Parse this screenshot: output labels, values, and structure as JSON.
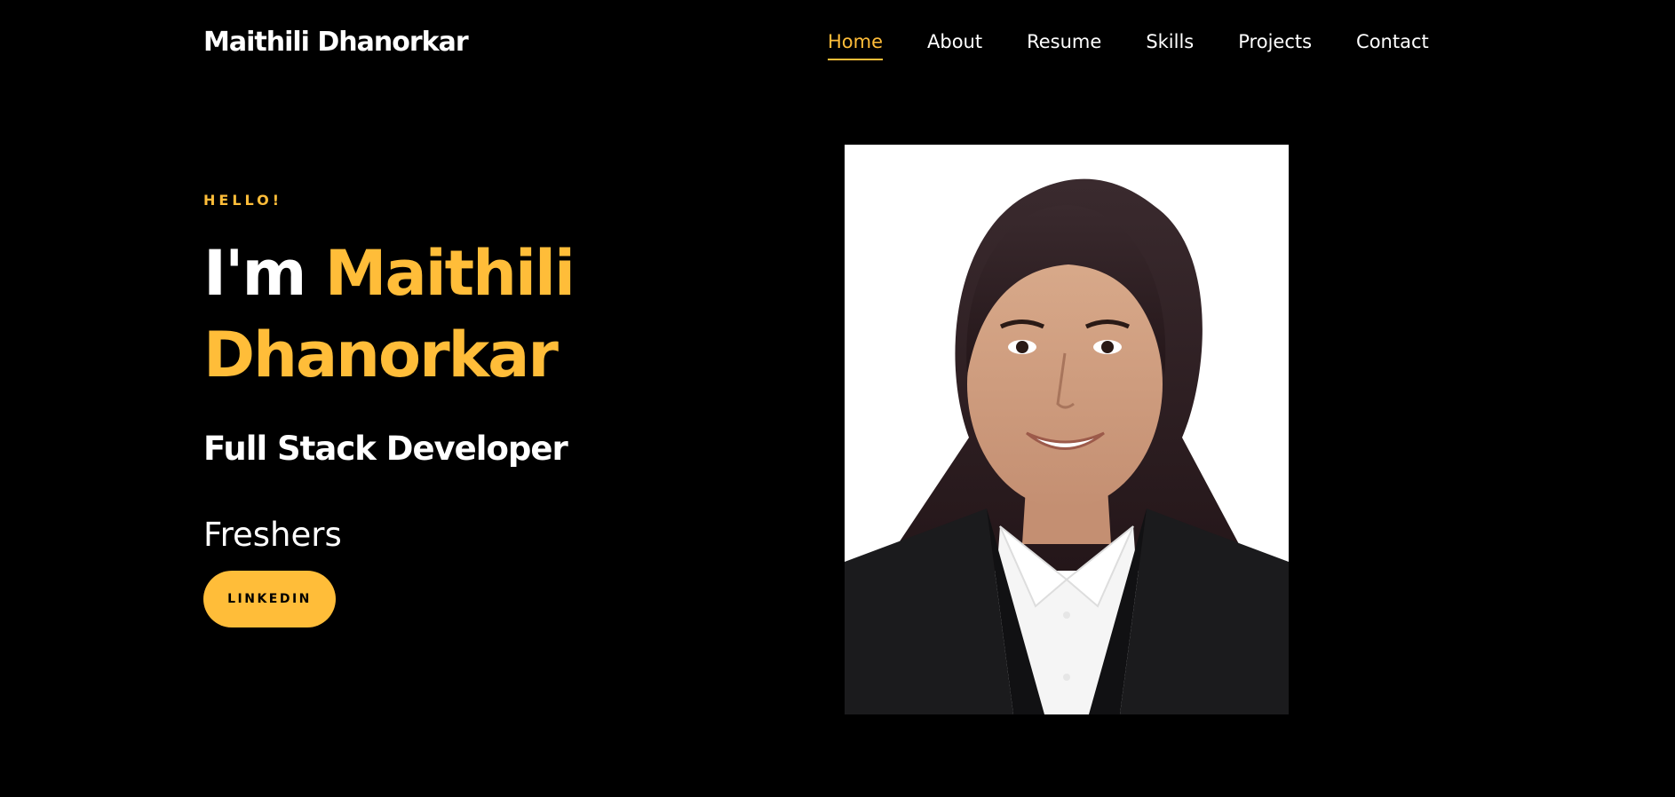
{
  "header": {
    "brand": "Maithili Dhanorkar",
    "nav": [
      {
        "label": "Home",
        "active": true
      },
      {
        "label": "About",
        "active": false
      },
      {
        "label": "Resume",
        "active": false
      },
      {
        "label": "Skills",
        "active": false
      },
      {
        "label": "Projects",
        "active": false
      },
      {
        "label": "Contact",
        "active": false
      }
    ]
  },
  "hero": {
    "greeting": "HELLO!",
    "intro": "I'm",
    "name_first": "Maithili",
    "name_last": "Dhanorkar",
    "role": "Full Stack Developer",
    "status": "Freshers",
    "cta_label": "LINKEDIN"
  },
  "colors": {
    "accent": "#ffbd39",
    "background": "#000000",
    "text": "#ffffff"
  }
}
